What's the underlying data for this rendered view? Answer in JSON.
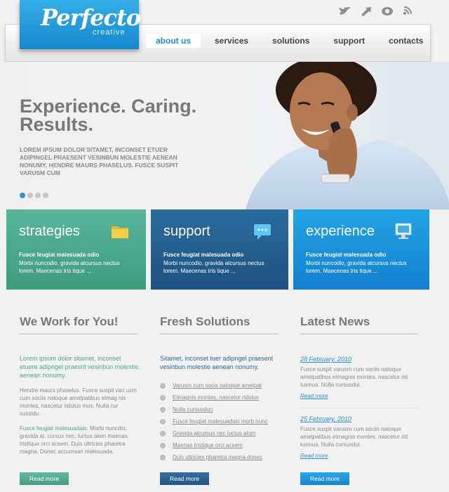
{
  "logo": {
    "main": "Perfecto",
    "sub": "creative"
  },
  "social_icons": [
    "twitter-icon",
    "forward-icon",
    "eye-icon",
    "rss-icon"
  ],
  "nav": [
    "about us",
    "services",
    "solutions",
    "support",
    "contacts"
  ],
  "hero": {
    "title_line1": "Experience. Caring.",
    "title_line2": "Results.",
    "text": "LOREM IPSUM DOLOR SITAMET, INCONSET ETUER ADIPINGEL PRAESENT VESINBUN MOLESTIE AENEAN NONUMY. HENDRE MAURS PHASELUS. FUSCE SUSPIT VARUSM CUM",
    "slides": 4,
    "active_slide": 1
  },
  "features": [
    {
      "title": "strategies",
      "icon": "folder-icon",
      "subtitle": "Fusce feugiat malesuada odio",
      "body": "Morbi nuncodio, gravida atcursus nectus lorem. Maecenas tris tique ...",
      "color": "#4aa98c"
    },
    {
      "title": "support",
      "icon": "chat-icon",
      "subtitle": "Fusce feugiat malesuada odio",
      "body": "Morbi nuncodio, gravida atcursus nectus lorem. Maecenas tris tique ...",
      "color": "#2a6b9c"
    },
    {
      "title": "experience",
      "icon": "monitor-icon",
      "subtitle": "Fusce feugiat malesuada odio",
      "body": "Morbi nuncodio, gravida atcursus nectus lorem. Maecenas tris tique ...",
      "color": "#1e95e0"
    }
  ],
  "col1": {
    "title": "We Work for You!",
    "lead": "Lorem ipsum dolor sitamet, inconset etuere adipngel praesnt vesinbun molestie aenean nonumy.",
    "p1": "Hendre maurs phaselus. Fusce suspit vari usm cum sociis natoque ametpatibus etmag nis montes, nascetur ridulus mus. Nulla cur sussidu.",
    "p2_green": "Fusce feugiat malesuadaio.",
    "p2_rest": " Morbi nuncdio, gravida at, cursus nec, luctus alom maenas tristique orci acsem. Duis ultricies pharetra magna. Donec accumsan malesuada.",
    "button": "Read more"
  },
  "col2": {
    "title": "Fresh Solutions",
    "lead": "Sitamet, inconset tuer adipngel praesent vesinbun molestie aenean nonumy.",
    "links": [
      "Varusm cum socis natoque ametpat",
      "Etmagnis montes, nascetur ridulus",
      "Nulla cursusdun",
      "Fusce feugiat malesuadaio morb nunc",
      "Gravida atcursus nec luctus alom",
      "Maenas tristique orci acsem",
      "Duis ultricies pharetra magna donec"
    ],
    "button": "Read more"
  },
  "col3": {
    "title": "Latest News",
    "news": [
      {
        "date": "28 February, 2010",
        "text": "Fusce suspit varusm cum sociis natoque ametpatibus etmagnis montes, nascetur rid iusmus. Nulla cursusdui.",
        "more": "Read more"
      },
      {
        "date": "25 February, 2010",
        "text": "Fusce suspit varusm cum sociis natoque ametpatibus etmagnis montes, nascetur rid iusmus. Nulla cursusdui.",
        "more": "Read more"
      }
    ],
    "button": "Read more"
  }
}
